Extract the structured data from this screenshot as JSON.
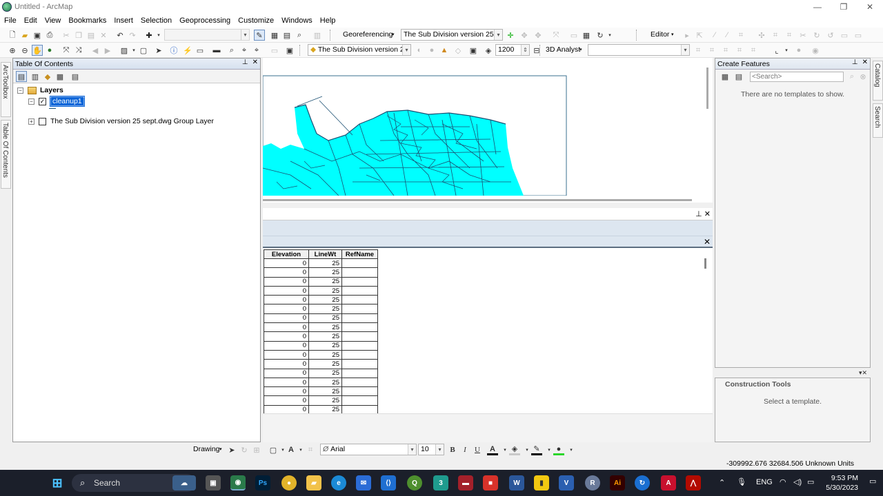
{
  "window": {
    "title": "Untitled - ArcMap",
    "min": "—",
    "max": "❐",
    "close": "✕"
  },
  "menu": [
    "File",
    "Edit",
    "View",
    "Bookmarks",
    "Insert",
    "Selection",
    "Geoprocessing",
    "Customize",
    "Windows",
    "Help"
  ],
  "toolbar1": {
    "georeferencing_label": "Georeferencing",
    "georef_layer": "The Sub Division version  25 sept",
    "editor_label": "Editor"
  },
  "toolbar2": {
    "layer_select": "The Sub Division version  2",
    "scale_value": "1200",
    "analyst_label": "3D Analyst"
  },
  "toc": {
    "title": "Table Of Contents",
    "root": "Layers",
    "layer1": "cleanup1",
    "layer2": "The Sub Division version  25 sept.dwg Group Layer"
  },
  "left_tabs": {
    "toolbox": "ArcToolbox",
    "toc": "Table Of Contents"
  },
  "right_tabs": {
    "catalog": "Catalog",
    "search": "Search"
  },
  "table": {
    "columns": [
      "Elevation",
      "LineWt",
      "RefName"
    ],
    "rows": [
      [
        "0",
        "25",
        ""
      ],
      [
        "0",
        "25",
        ""
      ],
      [
        "0",
        "25",
        ""
      ],
      [
        "0",
        "25",
        ""
      ],
      [
        "0",
        "25",
        ""
      ],
      [
        "0",
        "25",
        ""
      ],
      [
        "0",
        "25",
        ""
      ],
      [
        "0",
        "25",
        ""
      ],
      [
        "0",
        "25",
        ""
      ],
      [
        "0",
        "25",
        ""
      ],
      [
        "0",
        "25",
        ""
      ],
      [
        "0",
        "25",
        ""
      ],
      [
        "0",
        "25",
        ""
      ],
      [
        "0",
        "25",
        ""
      ],
      [
        "0",
        "25",
        ""
      ],
      [
        "0",
        "25",
        ""
      ],
      [
        "0",
        "25",
        ""
      ]
    ]
  },
  "create_features": {
    "title": "Create Features",
    "search_placeholder": "<Search>",
    "empty_msg": "There are no templates to show."
  },
  "construction_tools": {
    "title": "Construction Tools",
    "msg": "Select a template."
  },
  "drawing": {
    "label": "Drawing",
    "font": "Arial",
    "size": "10",
    "bold": "B",
    "italic": "I",
    "underline": "U"
  },
  "status": {
    "coords": "-309992.676  32684.506 Unknown Units"
  },
  "taskbar": {
    "search": "Search",
    "lang": "ENG",
    "time": "9:53 PM",
    "date": "5/30/2023"
  },
  "colors": {
    "map_fill": "#00ffff",
    "map_line": "#1b4f72",
    "taskbar": "#1b1f2a"
  }
}
